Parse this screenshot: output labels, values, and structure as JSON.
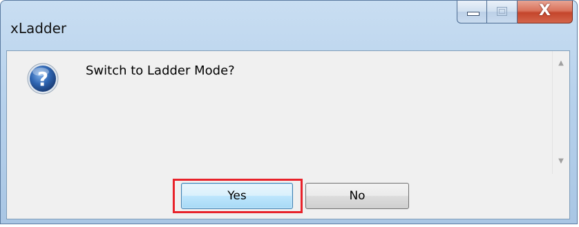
{
  "window": {
    "title": "xLadder",
    "close_symbol": "X"
  },
  "dialog": {
    "icon": "question-icon",
    "message": "Switch to Ladder Mode?",
    "yes_label": "Yes",
    "no_label": "No"
  },
  "colors": {
    "highlight": "#e8222a",
    "icon_blue": "#2a5fa8"
  }
}
